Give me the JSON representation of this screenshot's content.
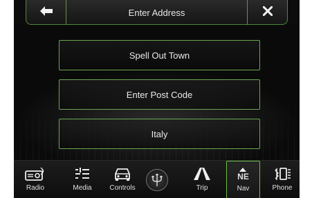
{
  "header": {
    "title": "Enter Address",
    "back_icon": "left-arrow-icon",
    "close_icon": "close-icon"
  },
  "options": [
    {
      "label": "Spell Out Town"
    },
    {
      "label": "Enter Post Code"
    },
    {
      "label": "Italy"
    }
  ],
  "navbar": {
    "items": [
      {
        "label": "Radio",
        "icon": "radio-icon"
      },
      {
        "label": "Media",
        "icon": "media-icon"
      },
      {
        "label": "Controls",
        "icon": "car-icon"
      },
      {
        "label": "",
        "icon": "trident-logo"
      },
      {
        "label": "Trip",
        "icon": "road-icon"
      },
      {
        "label": "Nav",
        "icon": "compass-icon",
        "compass_heading": "NE",
        "active": true
      },
      {
        "label": "Phone",
        "icon": "phone-icon"
      }
    ]
  },
  "colors": {
    "accent_green": "#6aa850",
    "background": "#0c0c0c",
    "text": "#e8e8e8"
  }
}
